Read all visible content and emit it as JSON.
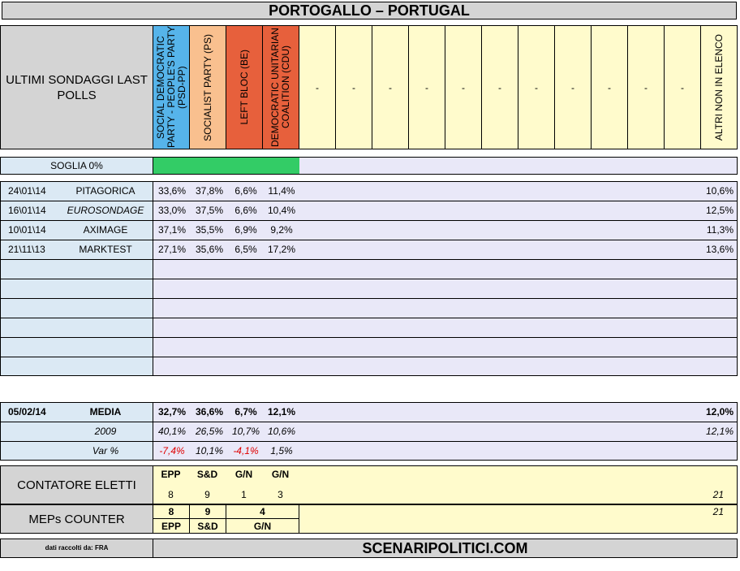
{
  "title": "PORTOGALLO – PORTUGAL",
  "header": {
    "label": "ULTIMI SONDAGGI LAST POLLS",
    "parties": [
      {
        "name": "SOCIAL DEMOCRATIC PARTY - PEOPLE'S PARTY (PSD-PP)",
        "color": "#56b4ea"
      },
      {
        "name": "SOCIALIST PARTY (PS)",
        "color": "#f9c08f"
      },
      {
        "name": "LEFT BLOC (BE)",
        "color": "#e7603c"
      },
      {
        "name": "DEMOCRATIC UNITARIAN COALITION (CDU)",
        "color": "#e7603c"
      }
    ],
    "empty_marker": "-",
    "others": "ALTRI NON IN ELENCO"
  },
  "threshold": {
    "label": "SOGLIA 0%",
    "bar_color": "#33cc66"
  },
  "polls": [
    {
      "date": "24\\01\\14",
      "institute": "PITAGORICA",
      "italic": false,
      "values": [
        "33,6%",
        "37,8%",
        "6,6%",
        "11,4%"
      ],
      "others": "10,6%"
    },
    {
      "date": "16\\01\\14",
      "institute": "EUROSONDAGE",
      "italic": true,
      "values": [
        "33,0%",
        "37,5%",
        "6,6%",
        "10,4%"
      ],
      "others": "12,5%"
    },
    {
      "date": "10\\01\\14",
      "institute": "AXIMAGE",
      "italic": false,
      "values": [
        "37,1%",
        "35,5%",
        "6,9%",
        "9,2%"
      ],
      "others": "11,3%"
    },
    {
      "date": "21\\11\\13",
      "institute": "MARKTEST",
      "italic": false,
      "values": [
        "27,1%",
        "35,6%",
        "6,5%",
        "17,2%"
      ],
      "others": "13,6%"
    }
  ],
  "summary": {
    "media": {
      "date": "05/02/14",
      "label": "MEDIA",
      "values": [
        "32,7%",
        "36,6%",
        "6,7%",
        "12,1%"
      ],
      "others": "12,0%"
    },
    "prev": {
      "label": "2009",
      "values": [
        "40,1%",
        "26,5%",
        "10,7%",
        "10,6%"
      ],
      "others": "12,1%"
    },
    "var": {
      "label": "Var %",
      "values": [
        "-7,4%",
        "10,1%",
        "-4,1%",
        "1,5%"
      ],
      "others": ""
    }
  },
  "contatore": {
    "label": "CONTATORE ELETTI",
    "groups": [
      "EPP",
      "S&D",
      "G/N",
      "G/N"
    ],
    "seats": [
      "8",
      "9",
      "1",
      "3"
    ],
    "total": "21"
  },
  "meps": {
    "label": "MEPs COUNTER",
    "seats": [
      "8",
      "9",
      "4"
    ],
    "groups": [
      "EPP",
      "S&D",
      "G/N"
    ],
    "total": "21"
  },
  "footer": {
    "credits": "dati raccolti da: FRA",
    "site": "SCENARIPOLITICI.COM"
  }
}
